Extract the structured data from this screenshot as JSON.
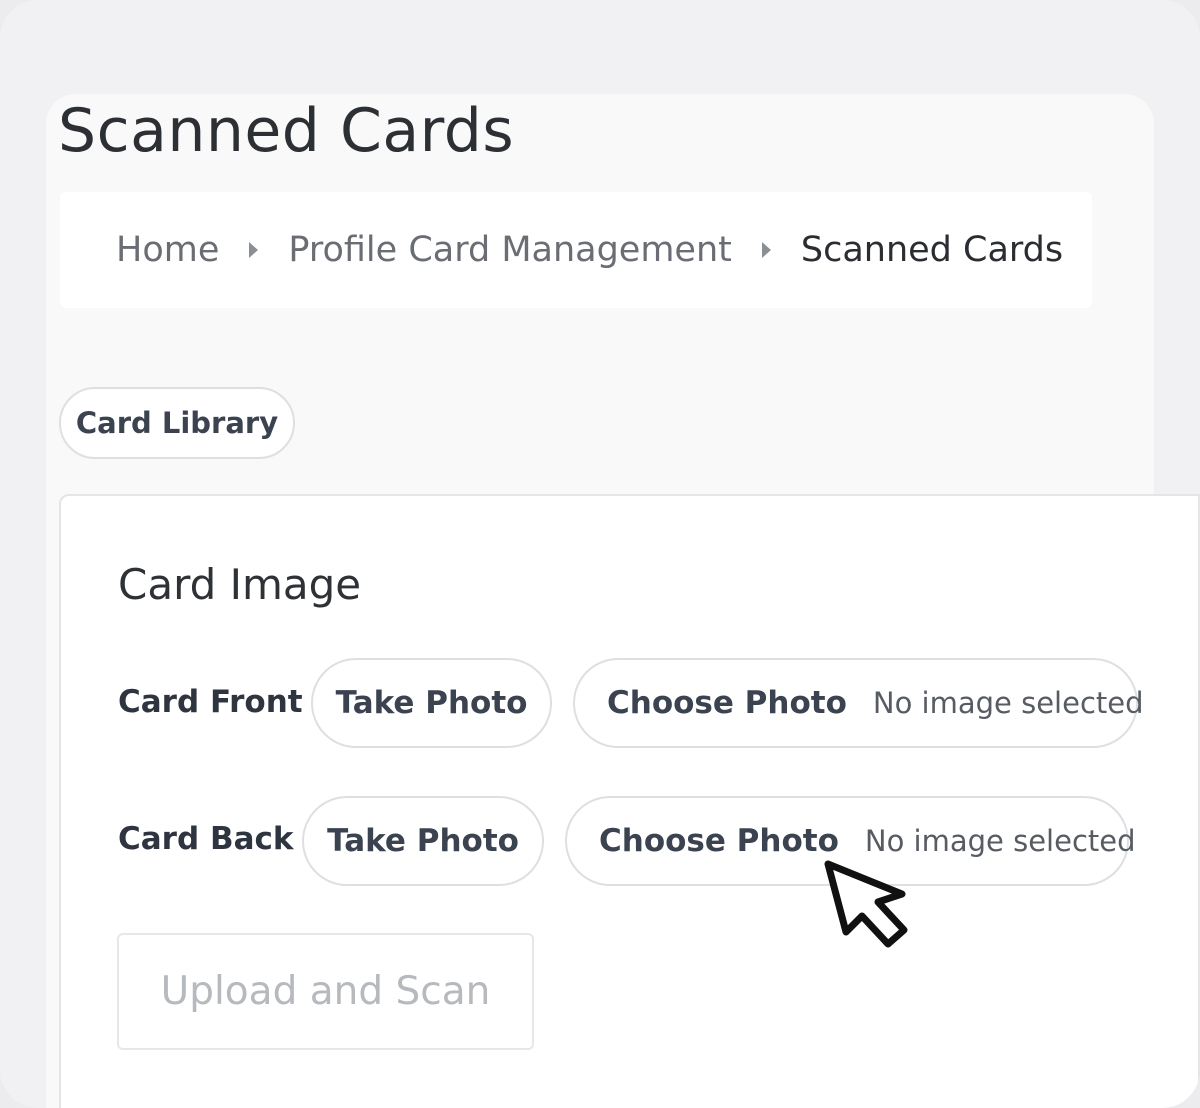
{
  "page": {
    "title": "Scanned Cards"
  },
  "breadcrumb": {
    "items": [
      {
        "label": "Home"
      },
      {
        "label": "Profile Card Management"
      },
      {
        "label": "Scanned Cards"
      }
    ]
  },
  "tabs": {
    "card_library": "Card Library"
  },
  "card_image": {
    "title": "Card Image",
    "front": {
      "label": "Card Front",
      "take_photo": "Take Photo",
      "choose_photo": "Choose Photo",
      "status": "No image selected"
    },
    "back": {
      "label": "Card Back",
      "take_photo": "Take Photo",
      "choose_photo": "Choose Photo",
      "status": "No image selected"
    },
    "upload_button": "Upload and Scan",
    "upload_enabled": false
  },
  "icons": {
    "cursor": "mouse-pointer-icon",
    "separator": "caret-right-icon"
  },
  "colors": {
    "background": "#f1f1f4",
    "text": "#2e3136",
    "border": "#dedfe2",
    "disabled_text": "#b6b9bd"
  }
}
